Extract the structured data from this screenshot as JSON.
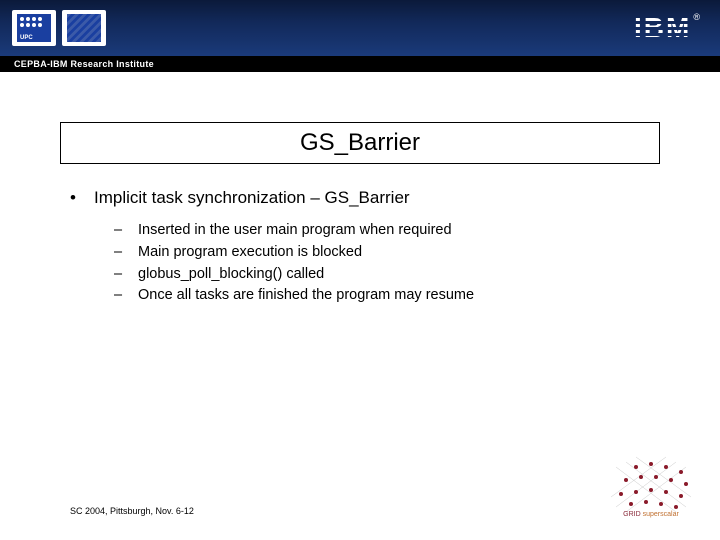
{
  "header": {
    "institute_text": "CEPBA-IBM Research Institute",
    "ibm_label": "IBM",
    "registered": "®"
  },
  "title": "GS_Barrier",
  "content": {
    "main_bullet": "Implicit task synchronization – GS_Barrier",
    "sub_bullets": [
      "Inserted in the user main program when required",
      "Main program execution is blocked",
      "globus_poll_blocking() called",
      "Once all tasks are finished the program may resume"
    ]
  },
  "footer": "SC 2004, Pittsburgh, Nov. 6-12",
  "logos": {
    "grid_label_1": "GRID",
    "grid_label_2": "superscalar"
  }
}
